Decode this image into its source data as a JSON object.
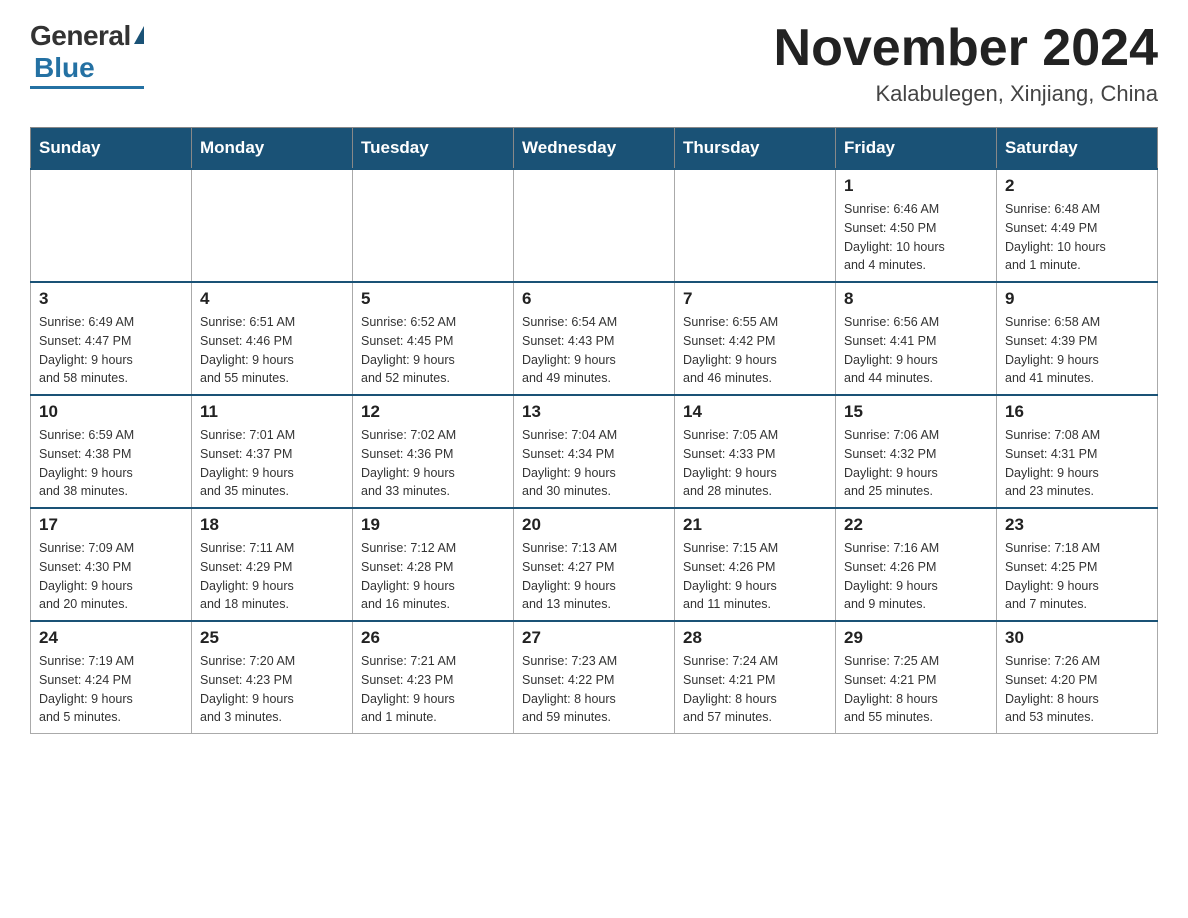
{
  "header": {
    "logo_general": "General",
    "logo_blue": "Blue",
    "month_title": "November 2024",
    "location": "Kalabulegen, Xinjiang, China"
  },
  "weekdays": [
    "Sunday",
    "Monday",
    "Tuesday",
    "Wednesday",
    "Thursday",
    "Friday",
    "Saturday"
  ],
  "weeks": [
    [
      {
        "day": "",
        "info": ""
      },
      {
        "day": "",
        "info": ""
      },
      {
        "day": "",
        "info": ""
      },
      {
        "day": "",
        "info": ""
      },
      {
        "day": "",
        "info": ""
      },
      {
        "day": "1",
        "info": "Sunrise: 6:46 AM\nSunset: 4:50 PM\nDaylight: 10 hours\nand 4 minutes."
      },
      {
        "day": "2",
        "info": "Sunrise: 6:48 AM\nSunset: 4:49 PM\nDaylight: 10 hours\nand 1 minute."
      }
    ],
    [
      {
        "day": "3",
        "info": "Sunrise: 6:49 AM\nSunset: 4:47 PM\nDaylight: 9 hours\nand 58 minutes."
      },
      {
        "day": "4",
        "info": "Sunrise: 6:51 AM\nSunset: 4:46 PM\nDaylight: 9 hours\nand 55 minutes."
      },
      {
        "day": "5",
        "info": "Sunrise: 6:52 AM\nSunset: 4:45 PM\nDaylight: 9 hours\nand 52 minutes."
      },
      {
        "day": "6",
        "info": "Sunrise: 6:54 AM\nSunset: 4:43 PM\nDaylight: 9 hours\nand 49 minutes."
      },
      {
        "day": "7",
        "info": "Sunrise: 6:55 AM\nSunset: 4:42 PM\nDaylight: 9 hours\nand 46 minutes."
      },
      {
        "day": "8",
        "info": "Sunrise: 6:56 AM\nSunset: 4:41 PM\nDaylight: 9 hours\nand 44 minutes."
      },
      {
        "day": "9",
        "info": "Sunrise: 6:58 AM\nSunset: 4:39 PM\nDaylight: 9 hours\nand 41 minutes."
      }
    ],
    [
      {
        "day": "10",
        "info": "Sunrise: 6:59 AM\nSunset: 4:38 PM\nDaylight: 9 hours\nand 38 minutes."
      },
      {
        "day": "11",
        "info": "Sunrise: 7:01 AM\nSunset: 4:37 PM\nDaylight: 9 hours\nand 35 minutes."
      },
      {
        "day": "12",
        "info": "Sunrise: 7:02 AM\nSunset: 4:36 PM\nDaylight: 9 hours\nand 33 minutes."
      },
      {
        "day": "13",
        "info": "Sunrise: 7:04 AM\nSunset: 4:34 PM\nDaylight: 9 hours\nand 30 minutes."
      },
      {
        "day": "14",
        "info": "Sunrise: 7:05 AM\nSunset: 4:33 PM\nDaylight: 9 hours\nand 28 minutes."
      },
      {
        "day": "15",
        "info": "Sunrise: 7:06 AM\nSunset: 4:32 PM\nDaylight: 9 hours\nand 25 minutes."
      },
      {
        "day": "16",
        "info": "Sunrise: 7:08 AM\nSunset: 4:31 PM\nDaylight: 9 hours\nand 23 minutes."
      }
    ],
    [
      {
        "day": "17",
        "info": "Sunrise: 7:09 AM\nSunset: 4:30 PM\nDaylight: 9 hours\nand 20 minutes."
      },
      {
        "day": "18",
        "info": "Sunrise: 7:11 AM\nSunset: 4:29 PM\nDaylight: 9 hours\nand 18 minutes."
      },
      {
        "day": "19",
        "info": "Sunrise: 7:12 AM\nSunset: 4:28 PM\nDaylight: 9 hours\nand 16 minutes."
      },
      {
        "day": "20",
        "info": "Sunrise: 7:13 AM\nSunset: 4:27 PM\nDaylight: 9 hours\nand 13 minutes."
      },
      {
        "day": "21",
        "info": "Sunrise: 7:15 AM\nSunset: 4:26 PM\nDaylight: 9 hours\nand 11 minutes."
      },
      {
        "day": "22",
        "info": "Sunrise: 7:16 AM\nSunset: 4:26 PM\nDaylight: 9 hours\nand 9 minutes."
      },
      {
        "day": "23",
        "info": "Sunrise: 7:18 AM\nSunset: 4:25 PM\nDaylight: 9 hours\nand 7 minutes."
      }
    ],
    [
      {
        "day": "24",
        "info": "Sunrise: 7:19 AM\nSunset: 4:24 PM\nDaylight: 9 hours\nand 5 minutes."
      },
      {
        "day": "25",
        "info": "Sunrise: 7:20 AM\nSunset: 4:23 PM\nDaylight: 9 hours\nand 3 minutes."
      },
      {
        "day": "26",
        "info": "Sunrise: 7:21 AM\nSunset: 4:23 PM\nDaylight: 9 hours\nand 1 minute."
      },
      {
        "day": "27",
        "info": "Sunrise: 7:23 AM\nSunset: 4:22 PM\nDaylight: 8 hours\nand 59 minutes."
      },
      {
        "day": "28",
        "info": "Sunrise: 7:24 AM\nSunset: 4:21 PM\nDaylight: 8 hours\nand 57 minutes."
      },
      {
        "day": "29",
        "info": "Sunrise: 7:25 AM\nSunset: 4:21 PM\nDaylight: 8 hours\nand 55 minutes."
      },
      {
        "day": "30",
        "info": "Sunrise: 7:26 AM\nSunset: 4:20 PM\nDaylight: 8 hours\nand 53 minutes."
      }
    ]
  ]
}
